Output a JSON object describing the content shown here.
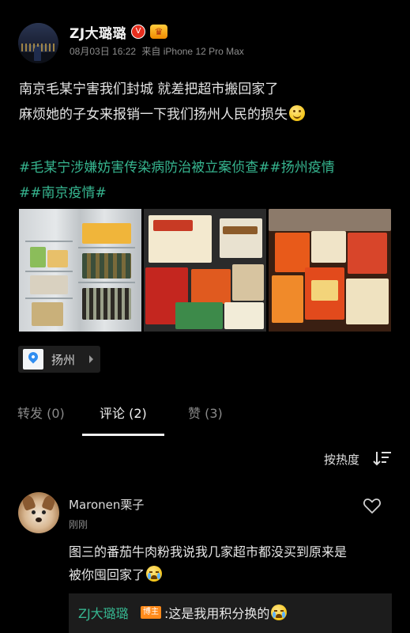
{
  "post": {
    "username": "ZJ大璐璐",
    "verified_badge": "V",
    "crown_badge": "♛",
    "date": "08月03日 16:22",
    "source": "来自 iPhone 12 Pro Max",
    "text_line1": "南京毛某宁害我们封城 就差把超市搬回家了",
    "text_line2": "麻烦她的子女来报销一下我们扬州人民的损失",
    "hashtag_line1": "#毛某宁涉嫌妨害传染病防治被立案侦查##扬州疫情",
    "hashtag_line2": "##南京疫情#",
    "images": [
      "refrigerator-photo",
      "instant-noodles-photo",
      "freezer-food-photo"
    ],
    "location": "扬州"
  },
  "tabs": [
    {
      "label": "转发 (0)"
    },
    {
      "label": "评论 (2)"
    },
    {
      "label": "赞 (3)"
    }
  ],
  "active_tab": "评论 (2)",
  "sort": {
    "label": "按热度"
  },
  "comment": {
    "author": "Maronen栗子",
    "time": "刚刚",
    "text_line1": "图三的番茄牛肉粉我说我几家超市都没买到原来是",
    "text_line2": "被你囤回家了",
    "reply": {
      "author": "ZJ大璐璐",
      "tag": "博主",
      "text": ":这是我用积分换的"
    }
  },
  "colors": {
    "background": "#000000",
    "hashtag": "#36b58f",
    "tab_active": "#f0f0f0",
    "tab_inactive": "#8a8a8a"
  }
}
